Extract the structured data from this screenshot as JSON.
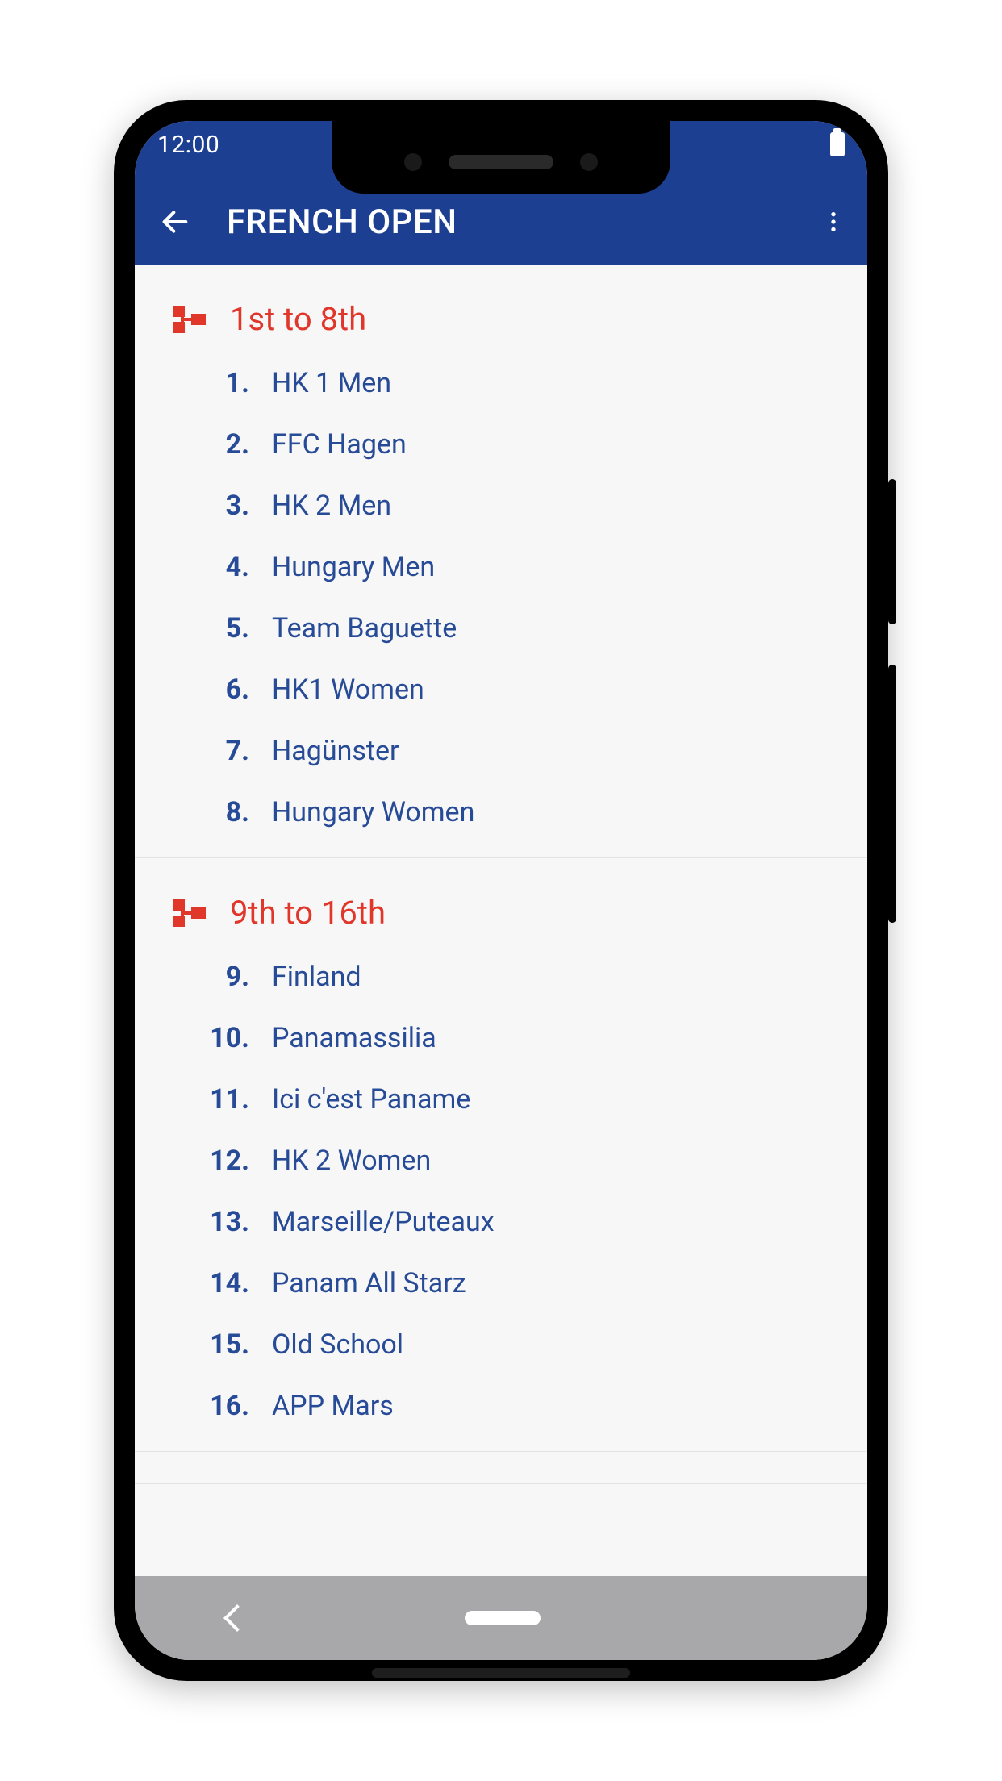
{
  "status": {
    "time": "12:00"
  },
  "header": {
    "title": "FRENCH OPEN"
  },
  "sections": [
    {
      "title": "1st to 8th",
      "items": [
        {
          "rank": "1.",
          "name": "HK 1 Men"
        },
        {
          "rank": "2.",
          "name": "FFC Hagen"
        },
        {
          "rank": "3.",
          "name": "HK 2 Men"
        },
        {
          "rank": "4.",
          "name": "Hungary Men"
        },
        {
          "rank": "5.",
          "name": "Team Baguette"
        },
        {
          "rank": "6.",
          "name": "HK1 Women"
        },
        {
          "rank": "7.",
          "name": "Hagünster"
        },
        {
          "rank": "8.",
          "name": "Hungary Women"
        }
      ]
    },
    {
      "title": "9th to 16th",
      "items": [
        {
          "rank": "9.",
          "name": "Finland"
        },
        {
          "rank": "10.",
          "name": "Panamassilia"
        },
        {
          "rank": "11.",
          "name": "Ici c'est Paname"
        },
        {
          "rank": "12.",
          "name": "HK 2 Women"
        },
        {
          "rank": "13.",
          "name": "Marseille/Puteaux"
        },
        {
          "rank": "14.",
          "name": "Panam All Starz"
        },
        {
          "rank": "15.",
          "name": "Old School"
        },
        {
          "rank": "16.",
          "name": "APP Mars"
        }
      ]
    }
  ]
}
